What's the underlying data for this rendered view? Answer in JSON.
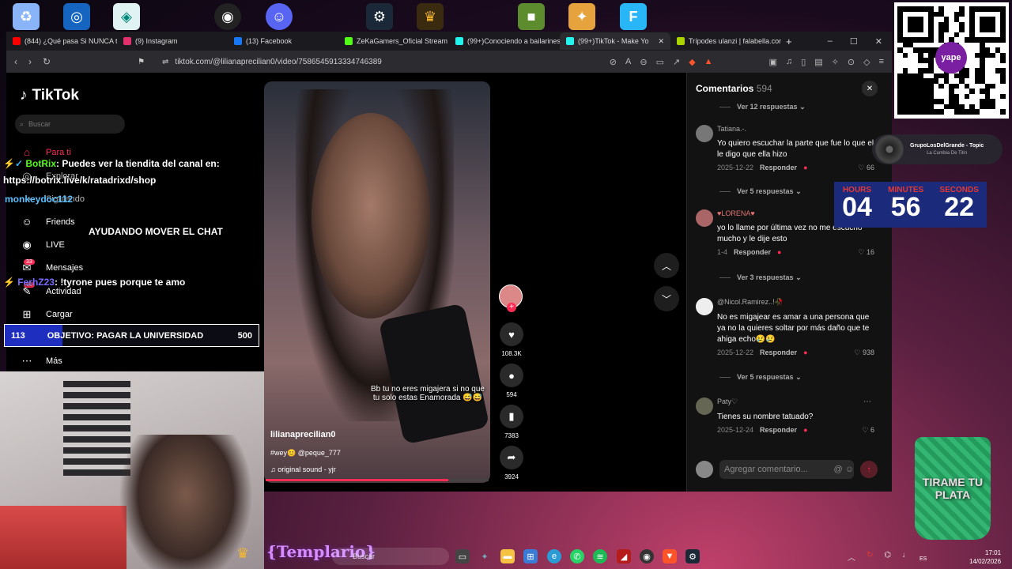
{
  "browser": {
    "tabs": [
      {
        "label": "(844) ¿Qué pasa Si NUNCA te",
        "color": "#ff0000"
      },
      {
        "label": "(9) Instagram",
        "color": "#e1306c"
      },
      {
        "label": "(13) Facebook",
        "color": "#1877f2"
      },
      {
        "label": "ZeKaGamers_Oficial Stream - ",
        "color": "#53fc18"
      },
      {
        "label": "(99+)Conociendo a bailarines",
        "color": "#25f4ee"
      },
      {
        "label": "(99+)TikTok - Make Yo",
        "color": "#25f4ee"
      },
      {
        "label": "Trípodes ulanzi | falabella.com",
        "color": "#aad400"
      }
    ],
    "url": "tiktok.com/@lilianaprecilian0/video/7586545913334746389"
  },
  "tiktok": {
    "logo": "TikTok",
    "search_placeholder": "Buscar",
    "nav": {
      "para_ti": "Para ti",
      "explorar": "Explorar",
      "siguiendo": "Siguiendo",
      "friends": "Friends",
      "live": "LIVE",
      "mensajes": "Mensajes",
      "mensajes_badge": "33",
      "actividad": "Actividad",
      "actividad_badge": "66",
      "cargar": "Cargar",
      "mas": "Más"
    },
    "video": {
      "caption": "Bb tu no eres migajera si no que tu solo estas Enamorada 😅😅",
      "username": "lilianaprecilian0",
      "description": "#wey😊 @peque_777",
      "sound": "original sound - yjr",
      "progress_fraction": 0.82
    },
    "actions": {
      "likes": "108.3K",
      "comments": "594",
      "saves": "7383",
      "shares": "3924"
    },
    "comments_panel": {
      "title": "Comentarios",
      "count": "594",
      "replies_1": "Ver 12 respuestas",
      "comments": [
        {
          "name": "Tatiana.-.",
          "text": "Yo quiero escuchar la parte que fue lo que el le digo que ella hizo",
          "date": "2025-12-22",
          "reply": "Responder",
          "likes": "66",
          "more": "Ver 5 respuestas"
        },
        {
          "name": "♥LORENA♥",
          "text": "yo lo llame por última vez no me escucho mucho y le dije esto",
          "date": "1-4",
          "reply": "Responder",
          "likes": "16",
          "more": "Ver 3 respuestas"
        },
        {
          "name": "@Nicol.Ramirez..!🥀",
          "text": "No es migajear es amar a una persona que ya no la quieres soltar por más daño que te ahiga echo😢😢",
          "date": "2025-12-22",
          "reply": "Responder",
          "likes": "938",
          "more": "Ver 5 respuestas"
        },
        {
          "name": "Paty♡",
          "text": "Tienes su nombre tatuado?",
          "date": "2025-12-24",
          "reply": "Responder",
          "likes": "6",
          "more": ""
        }
      ],
      "add_placeholder": "Agregar comentario..."
    }
  },
  "overlay": {
    "chat": [
      {
        "user": "BotRix",
        "msg": ": Puedes ver la tiendita del canal en:"
      },
      {
        "user": "",
        "msg": "https://botrix.live/k/ratadrixd/shop"
      },
      {
        "user": "monkeydoc112",
        "msg": ""
      },
      {
        "user": "",
        "msg": "AYUDANDO MOVER EL CHAT"
      },
      {
        "user": "FerhZ23",
        "msg": ": !tyrone pues porque te amo"
      }
    ],
    "goal": {
      "current": "113",
      "label": "OBJETIVO: PAGAR LA UNIVERSIDAD",
      "target": "500",
      "fraction": 0.226
    },
    "templario": "{Templario}",
    "music": {
      "artist": "GrupoLosDelGrande - Topic",
      "song": "La Cumbia De Tilín"
    },
    "timer": {
      "hours_label": "HOURS",
      "minutes_label": "MINUTES",
      "seconds_label": "SECONDS",
      "hours": "04",
      "minutes": "56",
      "seconds": "22"
    },
    "cup_text": "TIRAME TU PLATA",
    "yape": "yape"
  },
  "taskbar": {
    "search": "Buscar",
    "time": "17:01",
    "date": "14/02/2026",
    "lang": "ES"
  }
}
